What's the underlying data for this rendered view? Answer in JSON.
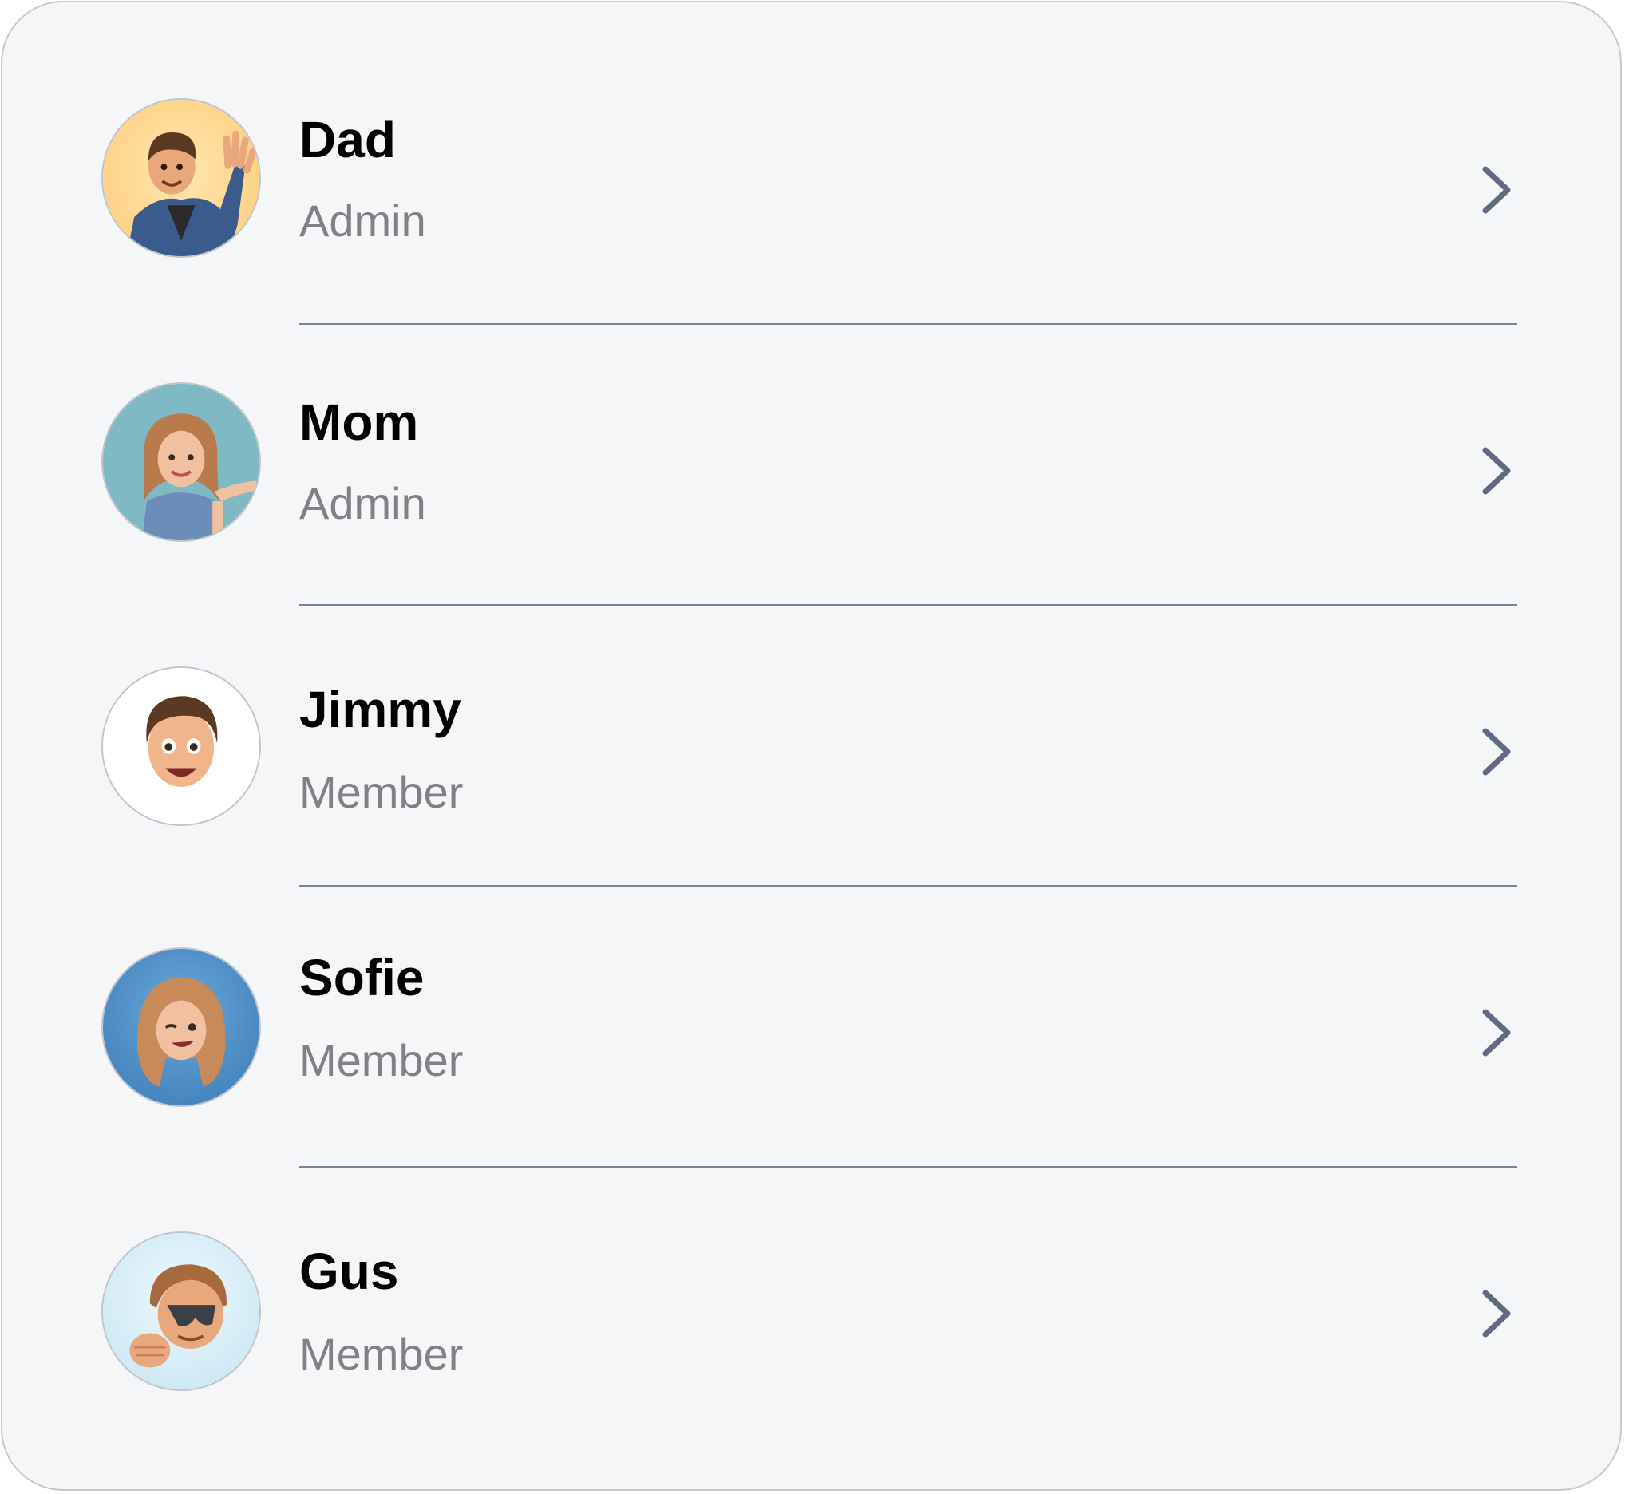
{
  "members": [
    {
      "name": "Dad",
      "role": "Admin",
      "avatar": "memoji-man-waving-icon",
      "avatar_bg": "#ffd990"
    },
    {
      "name": "Mom",
      "role": "Admin",
      "avatar": "memoji-woman-hand-raised-icon",
      "avatar_bg": "#7fb9c3"
    },
    {
      "name": "Jimmy",
      "role": "Member",
      "avatar": "memoji-boy-smiling-icon",
      "avatar_bg": "#ffffff"
    },
    {
      "name": "Sofie",
      "role": "Member",
      "avatar": "memoji-girl-winking-icon",
      "avatar_bg": "#4a8fc6"
    },
    {
      "name": "Gus",
      "role": "Member",
      "avatar": "memoji-boy-sunglasses-icon",
      "avatar_bg": "#d6eef8"
    }
  ],
  "colors": {
    "card_bg": "#f5f6f7",
    "name_text": "#000000",
    "role_text": "#808085",
    "chevron": "#5f6b80",
    "divider": "#7a8496"
  },
  "row_action_icon": "chevron-right-icon"
}
